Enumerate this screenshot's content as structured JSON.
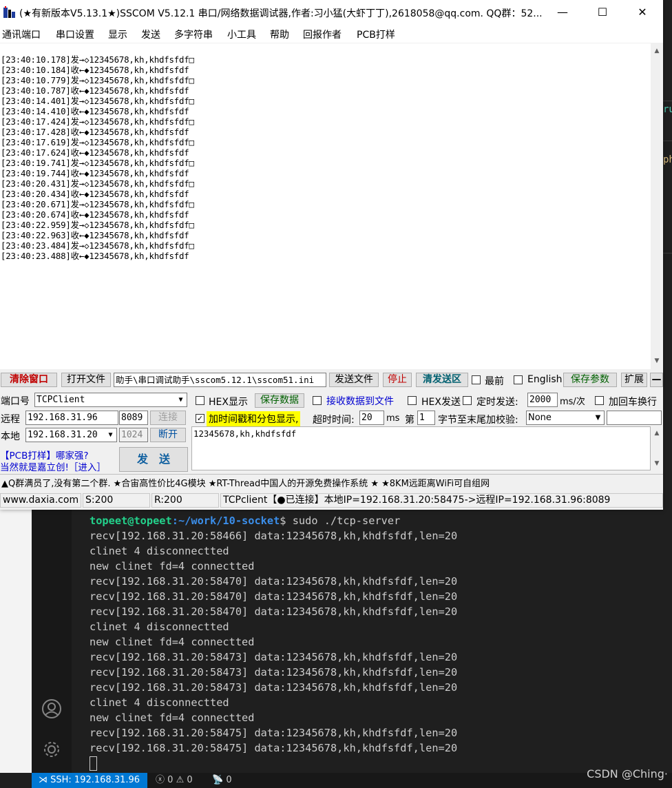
{
  "window": {
    "title": "(★有新版本V5.13.1★)SSCOM V5.12.1 串口/网络数据调试器,作者:习小猛(大虾丁丁),2618058@qq.com. QQ群：52...",
    "minimize_glyph": "—",
    "maximize_glyph": "☐",
    "close_glyph": "✕"
  },
  "menu": [
    "通讯端口",
    "串口设置",
    "显示",
    "发送",
    "多字符串",
    "小工具",
    "帮助",
    "回报作者",
    "PCB打样"
  ],
  "recv_lines": [
    "[23:40:10.178]发→◇12345678,kh,khdfsfdf□",
    "[23:40:10.184]收←◆12345678,kh,khdfsfdf",
    "[23:40:10.779]发→◇12345678,kh,khdfsfdf□",
    "[23:40:10.787]收←◆12345678,kh,khdfsfdf",
    "[23:40:14.401]发→◇12345678,kh,khdfsfdf□",
    "[23:40:14.410]收←◆12345678,kh,khdfsfdf",
    "[23:40:17.424]发→◇12345678,kh,khdfsfdf□",
    "[23:40:17.428]收←◆12345678,kh,khdfsfdf",
    "[23:40:17.619]发→◇12345678,kh,khdfsfdf□",
    "[23:40:17.624]收←◆12345678,kh,khdfsfdf",
    "[23:40:19.741]发→◇12345678,kh,khdfsfdf□",
    "[23:40:19.744]收←◆12345678,kh,khdfsfdf",
    "[23:40:20.431]发→◇12345678,kh,khdfsfdf□",
    "[23:40:20.434]收←◆12345678,kh,khdfsfdf",
    "[23:40:20.671]发→◇12345678,kh,khdfsfdf□",
    "[23:40:20.674]收←◆12345678,kh,khdfsfdf",
    "[23:40:22.959]发→◇12345678,kh,khdfsfdf□",
    "[23:40:22.963]收←◆12345678,kh,khdfsfdf",
    "[23:40:23.484]发→◇12345678,kh,khdfsfdf□",
    "[23:40:23.488]收←◆12345678,kh,khdfsfdf"
  ],
  "toolbar": {
    "clear": "清除窗口",
    "open_file": "打开文件",
    "file_path": "助手\\串口调试助手\\sscom5.12.1\\sscom51.ini",
    "send_file": "发送文件",
    "stop": "停止",
    "clear_send": "清发送区",
    "topmost": "最前",
    "english": "English",
    "save_params": "保存参数",
    "expand": "扩展",
    "collapse": "—"
  },
  "port": {
    "port_label": "端口号",
    "port_value": "TCPClient",
    "remote_label": "远程",
    "remote_ip": "192.168.31.96",
    "remote_port": "8089",
    "connect": "连接",
    "local_label": "本地",
    "local_ip": "192.168.31.20",
    "local_port": "1024",
    "disconnect": "断开",
    "ad1": "【PCB打样】哪家强?",
    "ad2": "当然就是嘉立创!［进入］",
    "send": "发　送"
  },
  "options": {
    "hex_display": "HEX显示",
    "save_data": "保存数据",
    "recv_to_file": "接收数据到文件",
    "hex_send": "HEX发送",
    "timed_send": "定时发送:",
    "interval": "2000",
    "interval_unit": "ms/次",
    "add_crlf": "加回车换行",
    "timestamp": "加时间戳和分包显示,",
    "timeout_label": "超时时间:",
    "timeout": "20",
    "timeout_unit": "ms",
    "nth_label": "第",
    "nth": "1",
    "checksum_label": "字节至末尾加校验:",
    "checksum": "None"
  },
  "send_text": "12345678,kh,khdfsfdf",
  "ad_bar": "▲Q群满员了,没有第二个群. ★合宙高性价比4G模块 ★RT-Thread中国人的开源免费操作系统 ★ ★8KM远距离WiFi可自组网",
  "status": {
    "site": "www.daxia.com",
    "sent": "S:200",
    "recv": "R:200",
    "conn": "TCPclient【●已连接】本地IP=192.168.31.20:58475->远程IP=192.168.31.96:8089"
  },
  "terminal": {
    "prompt_user": "topeet@topeet",
    "prompt_path": ":~/work/10-socket",
    "prompt_cmd": "$ sudo ./tcp-server",
    "lines": [
      "recv[192.168.31.20:58466] data:12345678,kh,khdfsfdf,len=20",
      "clinet 4 disconnectted",
      "new clinet fd=4 connectted",
      "recv[192.168.31.20:58470] data:12345678,kh,khdfsfdf,len=20",
      "recv[192.168.31.20:58470] data:12345678,kh,khdfsfdf,len=20",
      "recv[192.168.31.20:58470] data:12345678,kh,khdfsfdf,len=20",
      "clinet 4 disconnectted",
      "new clinet fd=4 connectted",
      "recv[192.168.31.20:58473] data:12345678,kh,khdfsfdf,len=20",
      "recv[192.168.31.20:58473] data:12345678,kh,khdfsfdf,len=20",
      "recv[192.168.31.20:58473] data:12345678,kh,khdfsfdf,len=20",
      "clinet 4 disconnectted",
      "new clinet fd=4 connectted",
      "recv[192.168.31.20:58475] data:12345678,kh,khdfsfdf,len=20",
      "recv[192.168.31.20:58475] data:12345678,kh,khdfsfdf,len=20"
    ]
  },
  "vscode_status": {
    "remote": "SSH: 192.168.31.96",
    "errors": "0",
    "warnings": "0",
    "ports": "0"
  },
  "side_fragments": [
    "ru",
    "ph"
  ],
  "watermark": "CSDN @Ching·"
}
